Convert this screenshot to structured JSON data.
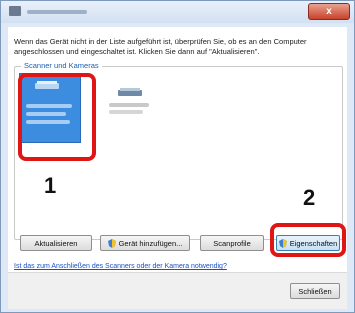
{
  "window": {
    "close_label": "x"
  },
  "instruction": "Wenn das Gerät nicht in der Liste aufgeführt ist, überprüfen Sie, ob es an den Computer angeschlossen und eingeschaltet ist. Klicken Sie dann auf \"Aktualisieren\".",
  "group": {
    "label": "Scanner und Kameras"
  },
  "markers": {
    "step1": "1",
    "step2": "2"
  },
  "buttons": {
    "refresh": "Aktualisieren",
    "add_device": "Gerät hinzufügen...",
    "scan_profiles": "Scanprofile",
    "properties": "Eigenschaften",
    "close": "Schließen"
  },
  "help_link": "Ist das zum Anschließen des Scanners oder der Kamera notwendig?",
  "colors": {
    "selection": "#3c8de0",
    "marker": "#e01515",
    "link": "#1a50c8"
  }
}
